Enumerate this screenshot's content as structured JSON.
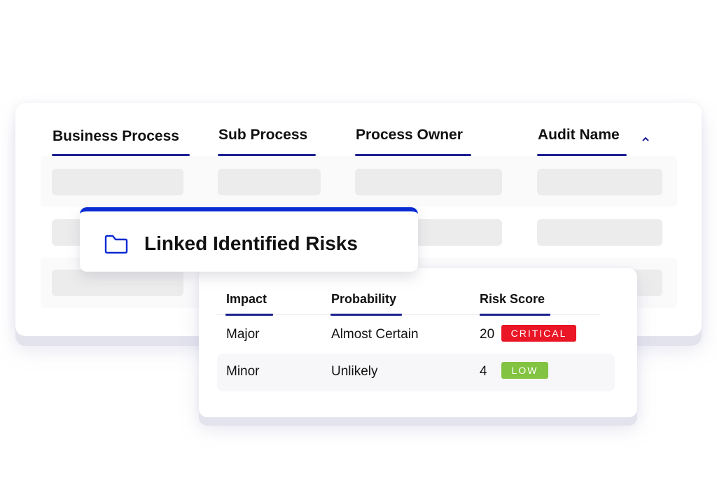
{
  "main_table": {
    "columns": [
      {
        "label": "Business Process"
      },
      {
        "label": "Sub Process"
      },
      {
        "label": "Process Owner"
      },
      {
        "label": "Audit Name",
        "sort_icon": "chevron-up-icon"
      }
    ],
    "rows_loading": 3
  },
  "linked_panel": {
    "icon": "folder-icon",
    "title": "Linked Identified Risks"
  },
  "risk_table": {
    "columns": [
      "Impact",
      "Probability",
      "Risk Score"
    ],
    "rows": [
      {
        "impact": "Major",
        "probability": "Almost Certain",
        "score": "20",
        "level": "CRITICAL",
        "level_color": "#ea1525"
      },
      {
        "impact": "Minor",
        "probability": "Unlikely",
        "score": "4",
        "level": "LOW",
        "level_color": "#82c341"
      }
    ]
  },
  "colors": {
    "accent": "#0a2bd1",
    "underline": "#1c2191",
    "critical": "#ea1525",
    "low": "#82c341",
    "skeleton": "#ececec"
  }
}
